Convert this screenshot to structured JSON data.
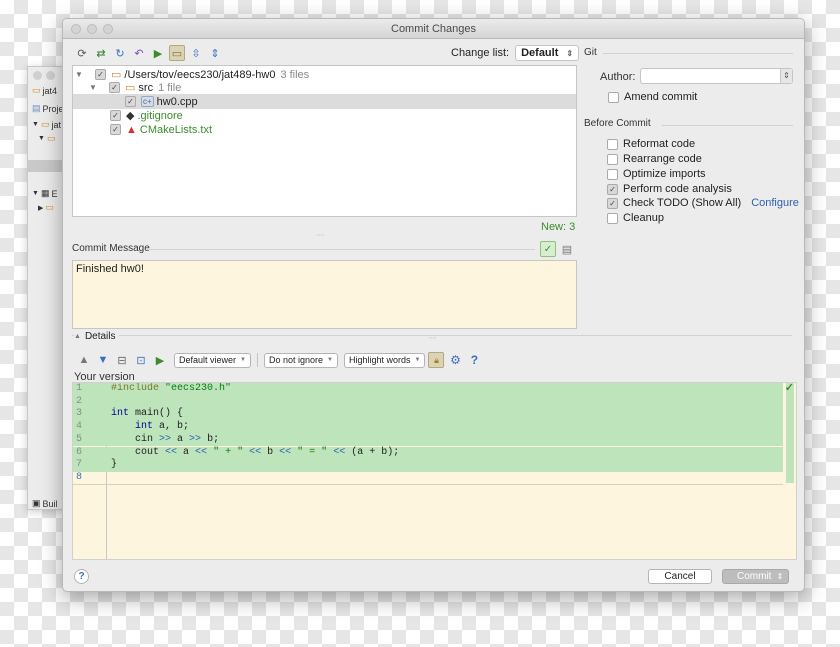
{
  "bg_window": {
    "title": "jat4",
    "items": [
      "Proje",
      "jat",
      "E",
      "Buil"
    ]
  },
  "window": {
    "title": "Commit Changes"
  },
  "changelist": {
    "label": "Change list:",
    "value": "Default"
  },
  "toolbar": {
    "icons": [
      "refresh-icon",
      "move-icon",
      "rollback-icon",
      "undo-icon",
      "diff-icon",
      "group-icon",
      "expand-icon",
      "collapse-icon"
    ]
  },
  "filetree": {
    "root": {
      "path": "/Users/tov/eecs230/jat489-hw0",
      "count": "3 files"
    },
    "src": {
      "name": "src",
      "count": "1 file"
    },
    "files": [
      {
        "name": "hw0.cpp"
      },
      {
        "name": ".gitignore"
      },
      {
        "name": "CMakeLists.txt"
      }
    ],
    "summary": "New: 3"
  },
  "commit_message": {
    "label": "Commit Message",
    "text": "Finished hw0!"
  },
  "git": {
    "title": "Git",
    "author_label": "Author:",
    "author_value": "",
    "amend_label": "Amend commit"
  },
  "before_commit": {
    "title": "Before Commit",
    "options": [
      {
        "label": "Reformat code",
        "checked": false
      },
      {
        "label": "Rearrange code",
        "checked": false
      },
      {
        "label": "Optimize imports",
        "checked": false
      },
      {
        "label": "Perform code analysis",
        "checked": true
      },
      {
        "label": "Check TODO (Show All)",
        "checked": true
      },
      {
        "label": "Cleanup",
        "checked": false
      }
    ],
    "configure_link": "Configure"
  },
  "details": {
    "label": "Details",
    "viewer": "Default viewer",
    "ignore": "Do not ignore",
    "highlight": "Highlight words",
    "your_version": "Your version"
  },
  "code": {
    "lines": [
      {
        "n": "1",
        "text": "#include \"eecs230.h\""
      },
      {
        "n": "2",
        "text": ""
      },
      {
        "n": "3",
        "text": "int main() {"
      },
      {
        "n": "4",
        "text": "    int a, b;"
      },
      {
        "n": "5",
        "text": "    cin >> a >> b;"
      },
      {
        "n": "6",
        "text": "    cout << a << \" + \" << b << \" = \" << (a + b);"
      },
      {
        "n": "7",
        "text": "}"
      },
      {
        "n": "8",
        "text": ""
      }
    ]
  },
  "buttons": {
    "help": "?",
    "cancel": "Cancel",
    "commit": "Commit"
  },
  "colors": {
    "added_bg": "#bee4bc",
    "message_bg": "#fdf5de",
    "link": "#2d5fb0",
    "new_files": "#3b8d2b"
  }
}
